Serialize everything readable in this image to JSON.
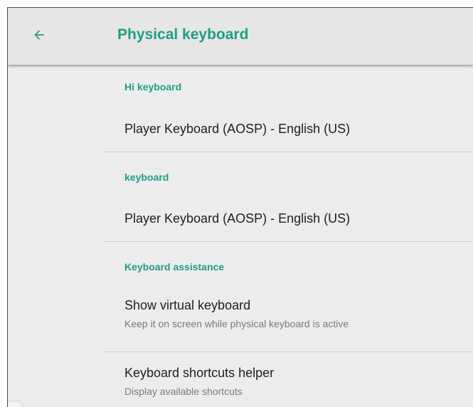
{
  "appbar": {
    "back_icon": "arrow-back-icon",
    "title": "Physical keyboard"
  },
  "colors": {
    "accent": "#1f9e82",
    "background": "#ececec",
    "appbar": "#e6e6e6",
    "primary_text": "#1e1e1e",
    "secondary_text": "#7a7a7a",
    "divider": "#cfcfcf"
  },
  "sections": [
    {
      "header": "Hi keyboard",
      "items": [
        {
          "title": "Player Keyboard (AOSP) - English (US)"
        }
      ]
    },
    {
      "header": "keyboard",
      "items": [
        {
          "title": "Player Keyboard (AOSP) - English (US)"
        }
      ]
    },
    {
      "header": "Keyboard assistance",
      "items": [
        {
          "title": "Show virtual keyboard",
          "summary": "Keep it on screen while physical keyboard is active"
        },
        {
          "title": "Keyboard shortcuts helper",
          "summary": "Display available shortcuts"
        }
      ]
    }
  ]
}
